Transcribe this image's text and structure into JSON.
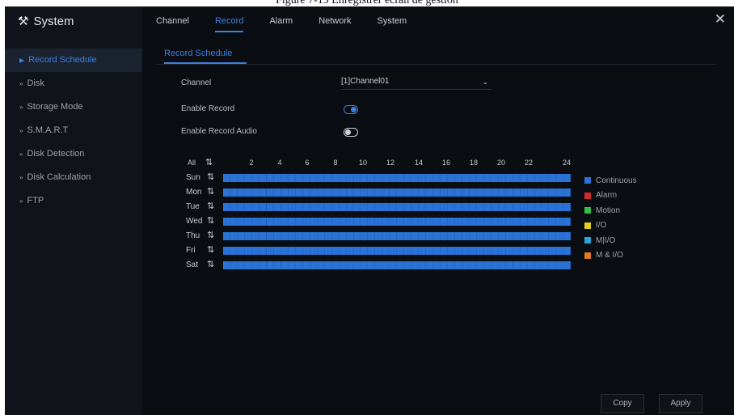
{
  "caption": "Figure 7-19  Enregistrer écran de gestion",
  "app": {
    "title": "System",
    "close_icon": "close-icon"
  },
  "sidebar": {
    "items": [
      {
        "label": "Record Schedule",
        "active": true
      },
      {
        "label": "Disk"
      },
      {
        "label": "Storage Mode"
      },
      {
        "label": "S.M.A.R.T"
      },
      {
        "label": "Disk Detection"
      },
      {
        "label": "Disk Calculation"
      },
      {
        "label": "FTP"
      }
    ]
  },
  "topnav": {
    "tabs": [
      {
        "label": "Channel"
      },
      {
        "label": "Record",
        "active": true
      },
      {
        "label": "Alarm"
      },
      {
        "label": "Network"
      },
      {
        "label": "System"
      }
    ]
  },
  "subtab": {
    "label": "Record Schedule"
  },
  "form": {
    "channel_label": "Channel",
    "channel_value": "[1]Channel01",
    "enable_record_label": "Enable Record",
    "enable_record": true,
    "enable_audio_label": "Enable Record Audio",
    "enable_audio": false
  },
  "schedule": {
    "all_label": "All",
    "hours": [
      "2",
      "4",
      "6",
      "8",
      "10",
      "12",
      "14",
      "16",
      "18",
      "20",
      "22",
      "24"
    ],
    "days": [
      "Sun",
      "Mon",
      "Tue",
      "Wed",
      "Thu",
      "Fri",
      "Sat"
    ],
    "coverage": "00:00-24:00 Continuous (all days)"
  },
  "legend": [
    {
      "label": "Continuous",
      "color": "#2a72d6"
    },
    {
      "label": "Alarm",
      "color": "#d12b2b"
    },
    {
      "label": "Motion",
      "color": "#2fbf4a"
    },
    {
      "label": "I/O",
      "color": "#d9d51f"
    },
    {
      "label": "M|I/O",
      "color": "#29a7d8"
    },
    {
      "label": "M & I/O",
      "color": "#e07a22"
    }
  ],
  "buttons": {
    "copy": "Copy",
    "apply": "Apply"
  }
}
